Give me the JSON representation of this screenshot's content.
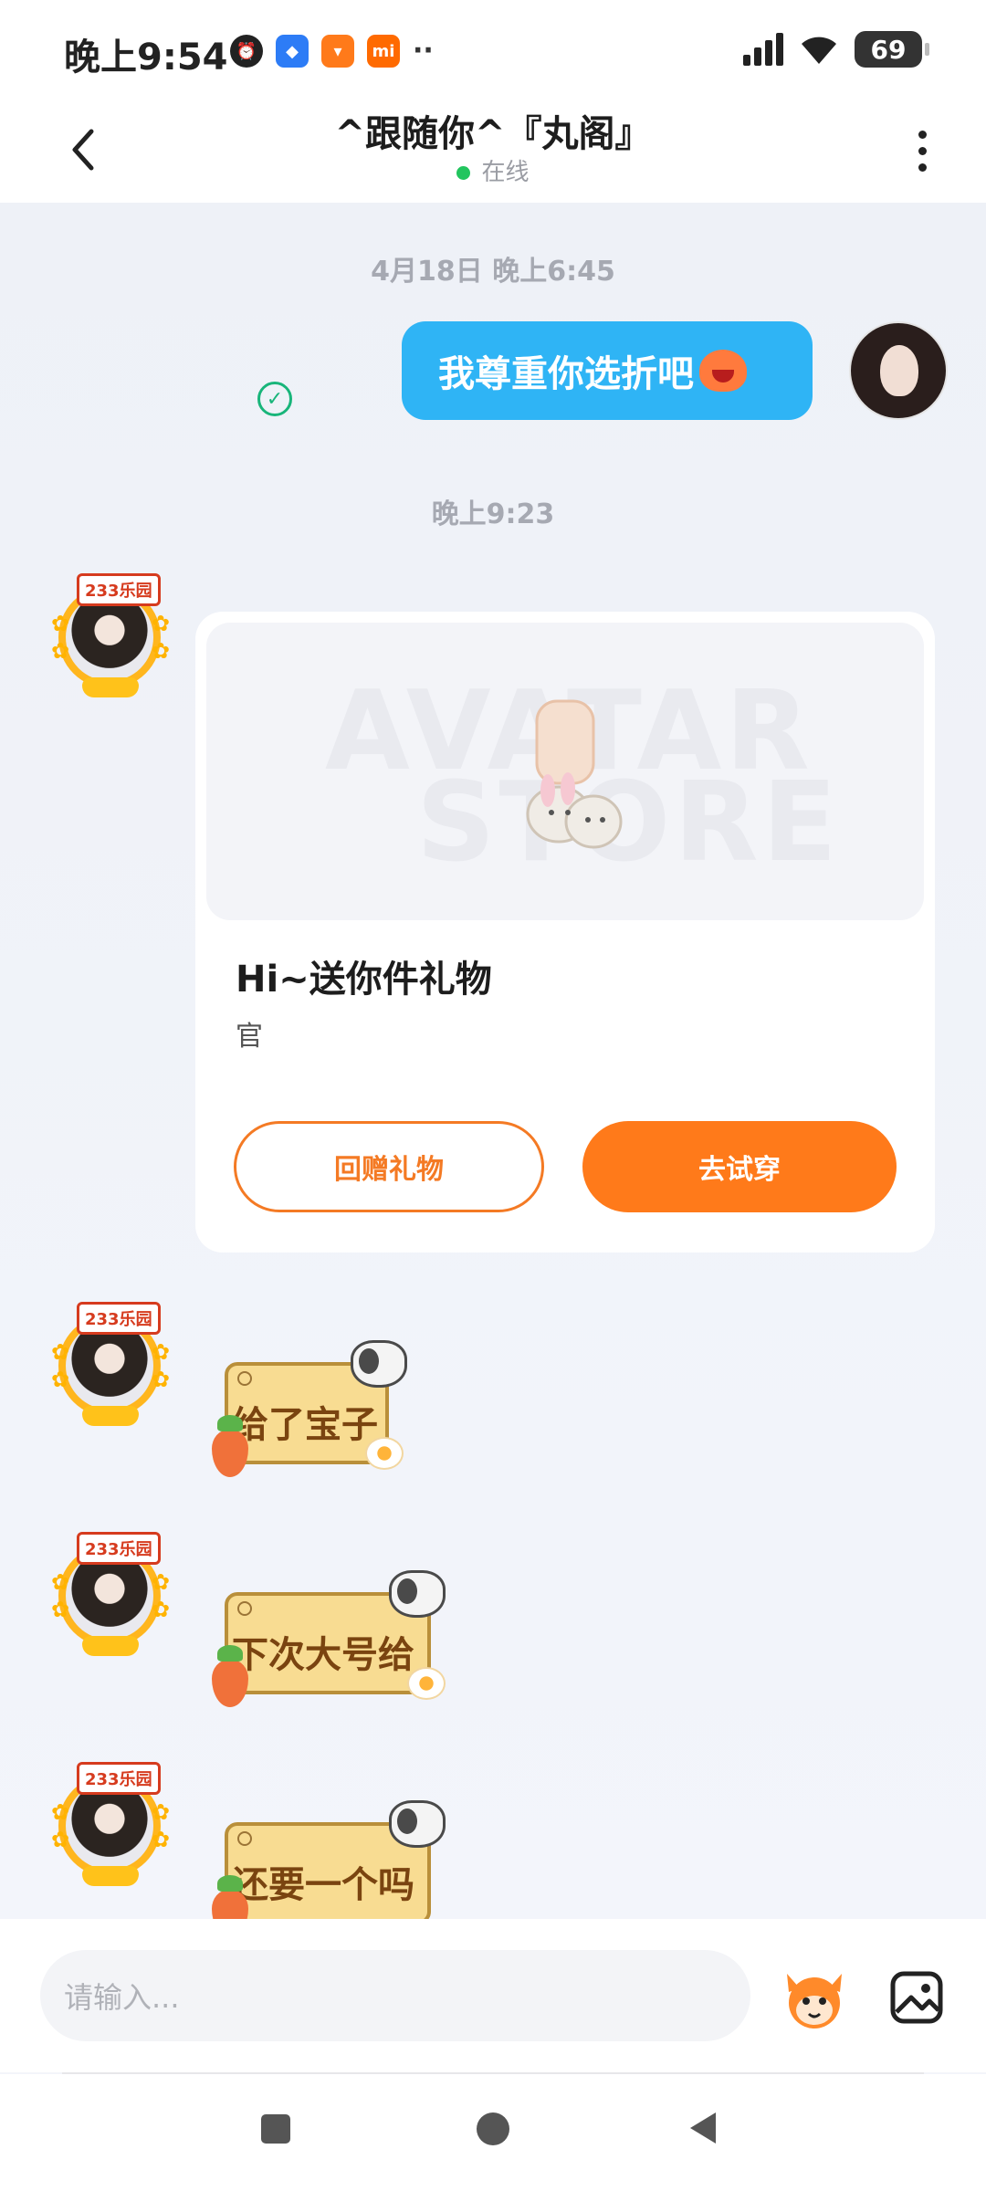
{
  "status_bar": {
    "time": "晚上9:54",
    "battery": "69",
    "app_icons": [
      "alarm-icon",
      "blue-app-icon",
      "orange-bag-icon",
      "mi-icon"
    ],
    "more_indicator": "··"
  },
  "header": {
    "title": "^跟随你^『丸阁』",
    "status": "在线"
  },
  "messages": {
    "timestamp_1": "4月18日 晚上6:45",
    "sent_text": "我尊重你选折吧",
    "timestamp_2": "晚上9:23",
    "avatar_badge": "233乐园",
    "gift_card": {
      "title": "Hi~送你件礼物",
      "subtitle": "官",
      "return_gift_label": "回赠礼物",
      "try_on_label": "去试穿",
      "watermark_line_1": "AVATAR",
      "watermark_line_2": "STORE"
    },
    "sticker_1": "给了宝子",
    "sticker_2": "下次大号给",
    "sticker_3": "还要一个吗"
  },
  "input": {
    "placeholder": "请输入..."
  },
  "colors": {
    "sent_bubble": "#2fb4f5",
    "accent_orange": "#ff7a1a",
    "online_green": "#22c55e",
    "note_bubble": "#f8dc92"
  }
}
